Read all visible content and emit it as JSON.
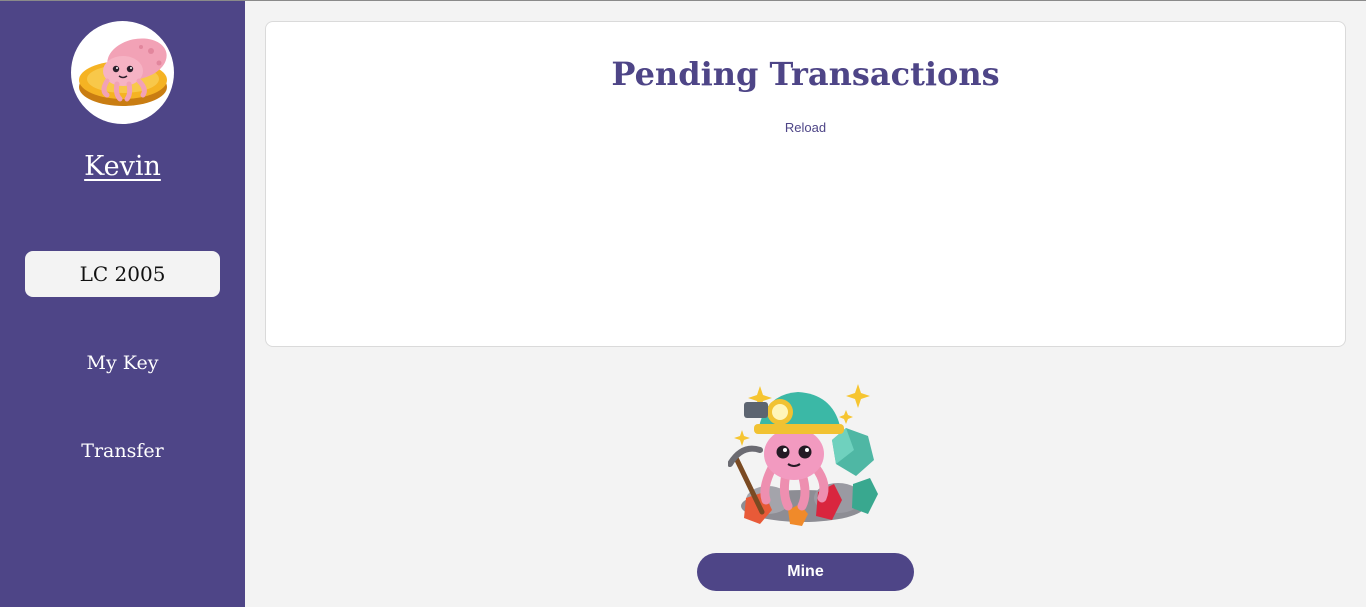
{
  "sidebar": {
    "username": "Kevin",
    "balance": "LC 2005",
    "nav": [
      {
        "label": "My Key"
      },
      {
        "label": "Transfer"
      }
    ]
  },
  "main": {
    "title": "Pending Transactions",
    "reload_label": "Reload",
    "mine_label": "Mine"
  },
  "colors": {
    "sidebar_bg": "#4e4587",
    "accent": "#4e4587",
    "page_bg": "#f3f3f3",
    "card_bg": "#ffffff"
  },
  "icons": {
    "avatar": "squid-on-gold-coin-icon",
    "miner": "squid-miner-with-gems-icon"
  }
}
